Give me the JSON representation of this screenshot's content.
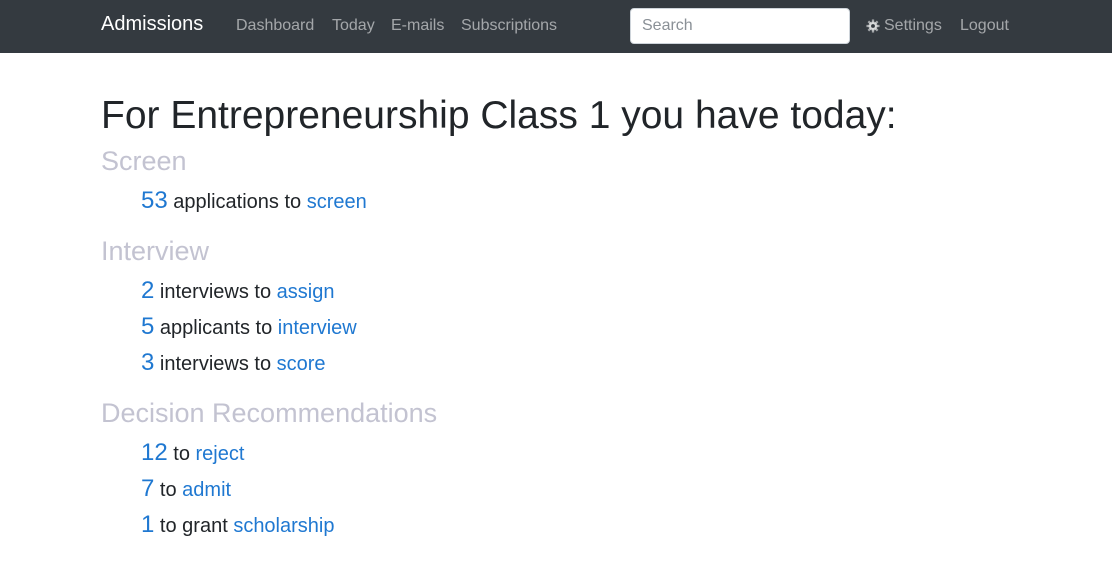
{
  "navbar": {
    "brand": "Admissions",
    "links": [
      "Dashboard",
      "Today",
      "E-mails",
      "Subscriptions"
    ],
    "search_placeholder": "Search",
    "settings_label": "Settings",
    "logout_label": "Logout",
    "settings_icon": "gear-icon"
  },
  "main": {
    "heading": "For Entrepreneurship Class 1 you have today:",
    "sections": [
      {
        "title": "Screen",
        "items": [
          {
            "count": "53",
            "text": "applications to",
            "link": "screen"
          }
        ]
      },
      {
        "title": "Interview",
        "items": [
          {
            "count": "2",
            "text": "interviews to",
            "link": "assign"
          },
          {
            "count": "5",
            "text": "applicants to",
            "link": "interview"
          },
          {
            "count": "3",
            "text": "interviews to",
            "link": "score"
          }
        ]
      },
      {
        "title": "Decision Recommendations",
        "items": [
          {
            "count": "12",
            "text": "to",
            "link": "reject"
          },
          {
            "count": "7",
            "text": "to",
            "link": "admit"
          },
          {
            "count": "1",
            "text": "to grant",
            "link": "scholarship"
          }
        ]
      }
    ]
  },
  "colors": {
    "navbar_bg": "#343a40",
    "link": "#1f78d1",
    "section_heading": "#c3c3d1"
  }
}
